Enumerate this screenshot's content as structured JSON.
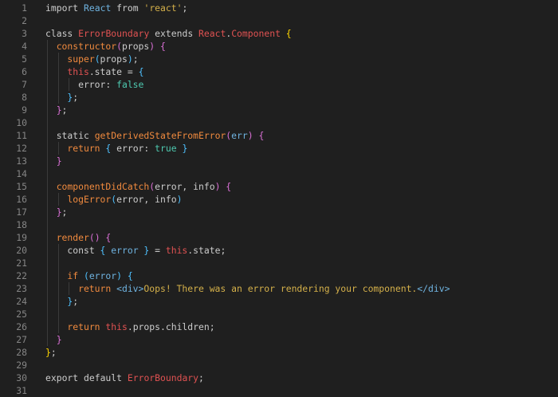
{
  "theme": {
    "background": "#1f1f1f",
    "line_number": "#858585",
    "default": "#cccccc",
    "keyword": "#cccccc",
    "class_name": "#e05252",
    "function": "#f08a3e",
    "param": "#6fb3e0",
    "string": "#d4b04a",
    "boolean": "#4ec9b0",
    "bracket_yellow": "#ffd700",
    "bracket_pink": "#da70d6",
    "bracket_blue": "#4fc1ff",
    "this": "#e05252",
    "jsx_tag": "#6fb3e0"
  },
  "lines": [
    {
      "n": "1",
      "indent": 0,
      "tokens": [
        [
          "import ",
          "default"
        ],
        [
          "React",
          "param"
        ],
        [
          " from ",
          "default"
        ],
        [
          "'react'",
          "string"
        ],
        [
          ";",
          "default"
        ]
      ]
    },
    {
      "n": "2",
      "indent": 0,
      "tokens": []
    },
    {
      "n": "3",
      "indent": 0,
      "tokens": [
        [
          "class ",
          "default"
        ],
        [
          "ErrorBoundary",
          "class_name"
        ],
        [
          " extends ",
          "default"
        ],
        [
          "React",
          "class_name"
        ],
        [
          ".",
          "default"
        ],
        [
          "Component",
          "class_name"
        ],
        [
          " ",
          "default"
        ],
        [
          "{",
          "bracket_yellow"
        ]
      ]
    },
    {
      "n": "4",
      "indent": 1,
      "tokens": [
        [
          "constructor",
          "function"
        ],
        [
          "(",
          "bracket_pink"
        ],
        [
          "props",
          "default"
        ],
        [
          ")",
          "bracket_pink"
        ],
        [
          " ",
          "default"
        ],
        [
          "{",
          "bracket_pink"
        ]
      ]
    },
    {
      "n": "5",
      "indent": 2,
      "tokens": [
        [
          "super",
          "function"
        ],
        [
          "(",
          "bracket_blue"
        ],
        [
          "props",
          "default"
        ],
        [
          ")",
          "bracket_blue"
        ],
        [
          ";",
          "default"
        ]
      ]
    },
    {
      "n": "6",
      "indent": 2,
      "tokens": [
        [
          "this",
          "this"
        ],
        [
          ".state = ",
          "default"
        ],
        [
          "{",
          "bracket_blue"
        ]
      ]
    },
    {
      "n": "7",
      "indent": 3,
      "tokens": [
        [
          "error",
          "default"
        ],
        [
          ": ",
          "default"
        ],
        [
          "false",
          "boolean"
        ]
      ]
    },
    {
      "n": "8",
      "indent": 2,
      "tokens": [
        [
          "}",
          "bracket_blue"
        ],
        [
          ";",
          "default"
        ]
      ]
    },
    {
      "n": "9",
      "indent": 1,
      "tokens": [
        [
          "}",
          "bracket_pink"
        ],
        [
          ";",
          "default"
        ]
      ]
    },
    {
      "n": "10",
      "indent": 0,
      "tokens": []
    },
    {
      "n": "11",
      "indent": 1,
      "tokens": [
        [
          "static ",
          "default"
        ],
        [
          "getDerivedStateFromError",
          "function"
        ],
        [
          "(",
          "bracket_pink"
        ],
        [
          "err",
          "param"
        ],
        [
          ")",
          "bracket_pink"
        ],
        [
          " ",
          "default"
        ],
        [
          "{",
          "bracket_pink"
        ]
      ]
    },
    {
      "n": "12",
      "indent": 2,
      "tokens": [
        [
          "return ",
          "function"
        ],
        [
          "{",
          "bracket_blue"
        ],
        [
          " error: ",
          "default"
        ],
        [
          "true",
          "boolean"
        ],
        [
          " ",
          "default"
        ],
        [
          "}",
          "bracket_blue"
        ]
      ]
    },
    {
      "n": "13",
      "indent": 1,
      "tokens": [
        [
          "}",
          "bracket_pink"
        ]
      ]
    },
    {
      "n": "14",
      "indent": 0,
      "tokens": []
    },
    {
      "n": "15",
      "indent": 1,
      "tokens": [
        [
          "componentDidCatch",
          "function"
        ],
        [
          "(",
          "bracket_pink"
        ],
        [
          "error, info",
          "default"
        ],
        [
          ")",
          "bracket_pink"
        ],
        [
          " ",
          "default"
        ],
        [
          "{",
          "bracket_pink"
        ]
      ]
    },
    {
      "n": "16",
      "indent": 2,
      "tokens": [
        [
          "logError",
          "function"
        ],
        [
          "(",
          "bracket_blue"
        ],
        [
          "error, info",
          "default"
        ],
        [
          ")",
          "bracket_blue"
        ]
      ]
    },
    {
      "n": "17",
      "indent": 1,
      "tokens": [
        [
          "}",
          "bracket_pink"
        ],
        [
          ";",
          "default"
        ]
      ]
    },
    {
      "n": "18",
      "indent": 0,
      "tokens": []
    },
    {
      "n": "19",
      "indent": 1,
      "tokens": [
        [
          "render",
          "function"
        ],
        [
          "()",
          "bracket_pink"
        ],
        [
          " ",
          "default"
        ],
        [
          "{",
          "bracket_pink"
        ]
      ]
    },
    {
      "n": "20",
      "indent": 2,
      "tokens": [
        [
          "const ",
          "default"
        ],
        [
          "{",
          "bracket_blue"
        ],
        [
          " error ",
          "param"
        ],
        [
          "}",
          "bracket_blue"
        ],
        [
          " = ",
          "default"
        ],
        [
          "this",
          "this"
        ],
        [
          ".state;",
          "default"
        ]
      ]
    },
    {
      "n": "21",
      "indent": 0,
      "tokens": []
    },
    {
      "n": "22",
      "indent": 2,
      "tokens": [
        [
          "if ",
          "function"
        ],
        [
          "(",
          "bracket_blue"
        ],
        [
          "error",
          "param"
        ],
        [
          ")",
          "bracket_blue"
        ],
        [
          " ",
          "default"
        ],
        [
          "{",
          "bracket_blue"
        ]
      ]
    },
    {
      "n": "23",
      "indent": 3,
      "tokens": [
        [
          "return ",
          "function"
        ],
        [
          "<div>",
          "jsx_tag"
        ],
        [
          "Oops! There was an error rendering your component.",
          "string"
        ],
        [
          "</div>",
          "jsx_tag"
        ]
      ]
    },
    {
      "n": "24",
      "indent": 2,
      "tokens": [
        [
          "}",
          "bracket_blue"
        ],
        [
          ";",
          "default"
        ]
      ]
    },
    {
      "n": "25",
      "indent": 0,
      "tokens": []
    },
    {
      "n": "26",
      "indent": 2,
      "tokens": [
        [
          "return ",
          "function"
        ],
        [
          "this",
          "this"
        ],
        [
          ".props.children;",
          "default"
        ]
      ]
    },
    {
      "n": "27",
      "indent": 1,
      "tokens": [
        [
          "}",
          "bracket_pink"
        ]
      ]
    },
    {
      "n": "28",
      "indent": 0,
      "tokens": [
        [
          "}",
          "bracket_yellow"
        ],
        [
          ";",
          "default"
        ]
      ]
    },
    {
      "n": "29",
      "indent": 0,
      "tokens": []
    },
    {
      "n": "30",
      "indent": 0,
      "tokens": [
        [
          "export default ",
          "default"
        ],
        [
          "ErrorBoundary",
          "class_name"
        ],
        [
          ";",
          "default"
        ]
      ]
    },
    {
      "n": "31",
      "indent": 0,
      "tokens": []
    }
  ]
}
